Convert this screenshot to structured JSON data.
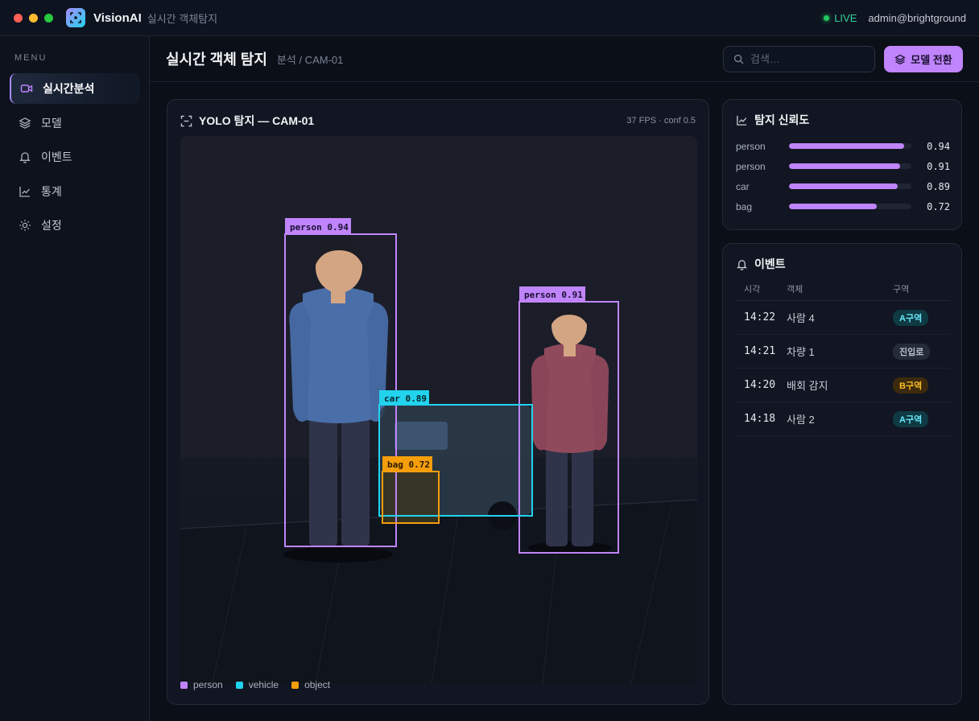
{
  "app": {
    "name": "VisionAI",
    "subtitle": "실시간 객체탐지",
    "status": "LIVE",
    "user": "admin@brightground"
  },
  "sidebar": {
    "menu_label": "MENU",
    "items": [
      {
        "label": "실시간분석",
        "icon": "video-icon",
        "active": true
      },
      {
        "label": "모델",
        "icon": "layers-icon",
        "active": false
      },
      {
        "label": "이벤트",
        "icon": "bell-icon",
        "active": false
      },
      {
        "label": "통계",
        "icon": "chart-icon",
        "active": false
      },
      {
        "label": "설정",
        "icon": "sun-settings-icon",
        "active": false
      }
    ]
  },
  "header": {
    "title": "실시간 객체 탐지",
    "breadcrumb": "분석 / CAM-01",
    "search_placeholder": "검색…",
    "model_button": "모델 전환"
  },
  "detection": {
    "title": "YOLO 탐지 — CAM-01",
    "meta": "37 FPS · conf 0.5",
    "boxes": [
      {
        "label": "person 0.94",
        "class": "person"
      },
      {
        "label": "person 0.91",
        "class": "person"
      },
      {
        "label": "car 0.89",
        "class": "vehicle"
      },
      {
        "label": "bag 0.72",
        "class": "object"
      }
    ],
    "legend": [
      {
        "label": "person",
        "color": "#c084fc"
      },
      {
        "label": "vehicle",
        "color": "#22d3ee"
      },
      {
        "label": "object",
        "color": "#f59e0b"
      }
    ]
  },
  "confidence": {
    "title": "탐지 신뢰도",
    "rows": [
      {
        "label": "person",
        "value": 0.94,
        "display": "0.94"
      },
      {
        "label": "person",
        "value": 0.91,
        "display": "0.91"
      },
      {
        "label": "car",
        "value": 0.89,
        "display": "0.89"
      },
      {
        "label": "bag",
        "value": 0.72,
        "display": "0.72"
      }
    ]
  },
  "events": {
    "title": "이벤트",
    "columns": [
      "시각",
      "객체",
      "구역"
    ],
    "rows": [
      {
        "time": "14:22",
        "object": "사람 4",
        "zone": "A구역",
        "zone_color": "teal"
      },
      {
        "time": "14:21",
        "object": "차량 1",
        "zone": "진입로",
        "zone_color": "gray"
      },
      {
        "time": "14:20",
        "object": "배회 감지",
        "zone": "B구역",
        "zone_color": "amber"
      },
      {
        "time": "14:18",
        "object": "사람 2",
        "zone": "A구역",
        "zone_color": "teal"
      }
    ]
  }
}
